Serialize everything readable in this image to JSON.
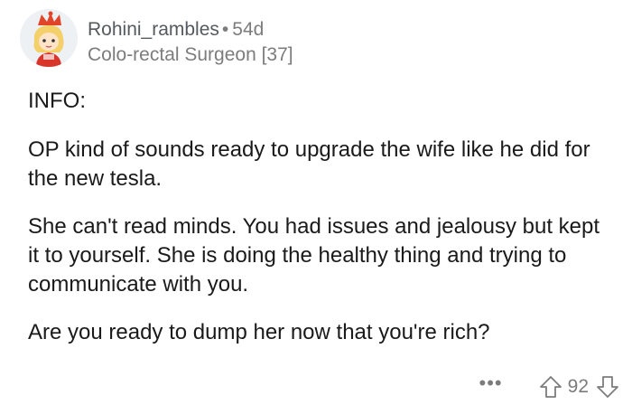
{
  "comment": {
    "username": "Rohini_rambles",
    "separator": "•",
    "age": "54d",
    "flair": "Colo-rectal Surgeon [37]",
    "paragraphs": [
      "INFO:",
      "OP kind of sounds ready to upgrade the wife like he did for the new tesla.",
      "She can't read minds. You had issues and jealousy but kept it to yourself. She is doing the healthy thing and trying to communicate with you.",
      "Are you ready to dump her now that you're rich?"
    ],
    "more_label": "•••",
    "score": "92"
  },
  "colors": {
    "text": "#1a1a1b",
    "meta": "#7c7c7c"
  },
  "icons": {
    "avatar": "avatar",
    "more": "more-options-icon",
    "upvote": "upvote-arrow-icon",
    "downvote": "downvote-arrow-icon"
  }
}
